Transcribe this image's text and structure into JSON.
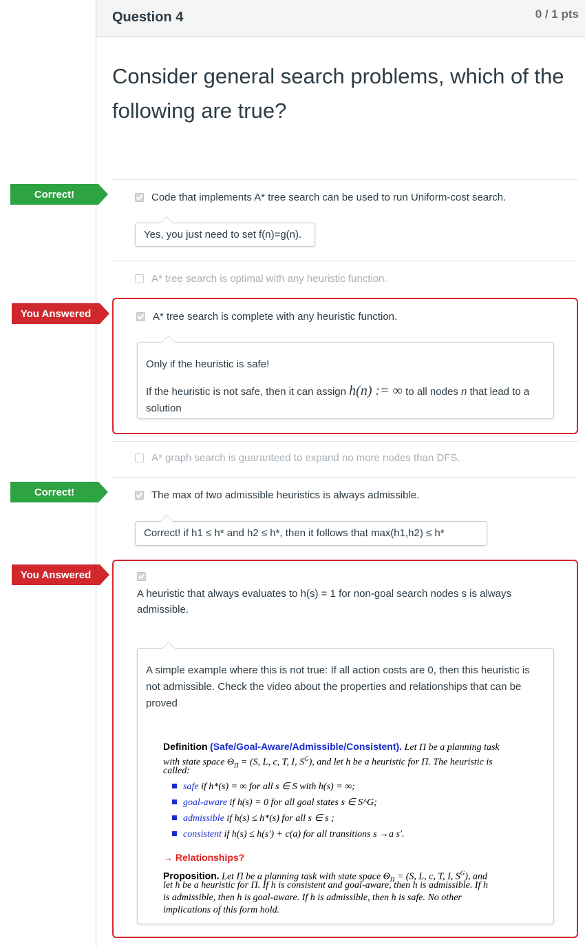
{
  "question": {
    "title": "Question 4",
    "points": "0 / 1 pts",
    "text": "Consider general search problems, which of the following are true?"
  },
  "flags": {
    "correct": "Correct!",
    "wrong": "You Answered"
  },
  "answers": [
    {
      "text": "Code that implements A* tree search can be used to run Uniform-cost search.",
      "checked": true,
      "comment": "Yes, you just need to set f(n)=g(n)."
    },
    {
      "text": "A* tree search is optimal with any heuristic function.",
      "checked": false
    },
    {
      "text": "A* tree search is complete with any heuristic function.",
      "checked": true,
      "comment_line1": "Only if the heuristic is safe!",
      "comment_line2_part1": "If the heuristic is not safe, then it can assign ",
      "comment_math": "h(n) := ∞",
      "comment_line2_part2": " to all nodes ",
      "comment_italic": "n",
      "comment_line2_part3": " that lead to a solution"
    },
    {
      "text": "A* graph search is guaranteed to expand no more nodes than DFS.",
      "checked": false
    },
    {
      "text": "The max of two admissible heuristics is always admissible.",
      "checked": true,
      "comment": "Correct! if h1 ≤ h* and h2 ≤ h*, then it follows that max(h1,h2) ≤ h*"
    },
    {
      "text": "A heuristic that always evaluates to h(s) = 1 for non-goal search nodes s is always admissible.",
      "checked": true,
      "comment": "A simple example where this is not true: If all action costs are 0, then this heuristic is not admissible. Check the video about the properties and relationships that can be proved"
    }
  ],
  "slide": {
    "def_label": "Definition",
    "def_title": "(Safe/Goal-Aware/Admissible/Consistent).",
    "def_line1": "Let Π be a planning task",
    "def_line2": "with state space Θ",
    "def_line2b": "Π",
    "def_line2c": " = (S, L, c, T, I, S",
    "def_line2d": "G",
    "def_line2e": "), and let h be a heuristic for Π. The heuristic is",
    "def_line3": "called:",
    "items": [
      {
        "term": "safe",
        "rest": " if h*(s) = ∞ for all s ∈ S with h(s) = ∞;"
      },
      {
        "term": "goal-aware",
        "rest": " if h(s) = 0 for all goal states s ∈ S^G;"
      },
      {
        "term": "admissible",
        "rest": " if h(s) ≤ h*(s) for all s ∈ s ;"
      },
      {
        "term": "consistent",
        "rest": " if h(s) ≤ h(s′) + c(a) for all transitions s →a s′."
      }
    ],
    "relationships": "→ Relationships?",
    "prop_label": "Proposition.",
    "prop_line1": "Let Π be a planning task with state space Θ",
    "prop_line1b": "Π",
    "prop_line1c": " = (S, L, c, T, I, S",
    "prop_line1d": "G",
    "prop_line1e": "), and",
    "prop_line2": "let h be a heuristic for Π. If h is consistent and goal-aware, then h is admissible. If h",
    "prop_line3": "is admissible, then h is goal-aware. If h is admissible, then h is safe. No other",
    "prop_line4": "implications of this form hold."
  }
}
